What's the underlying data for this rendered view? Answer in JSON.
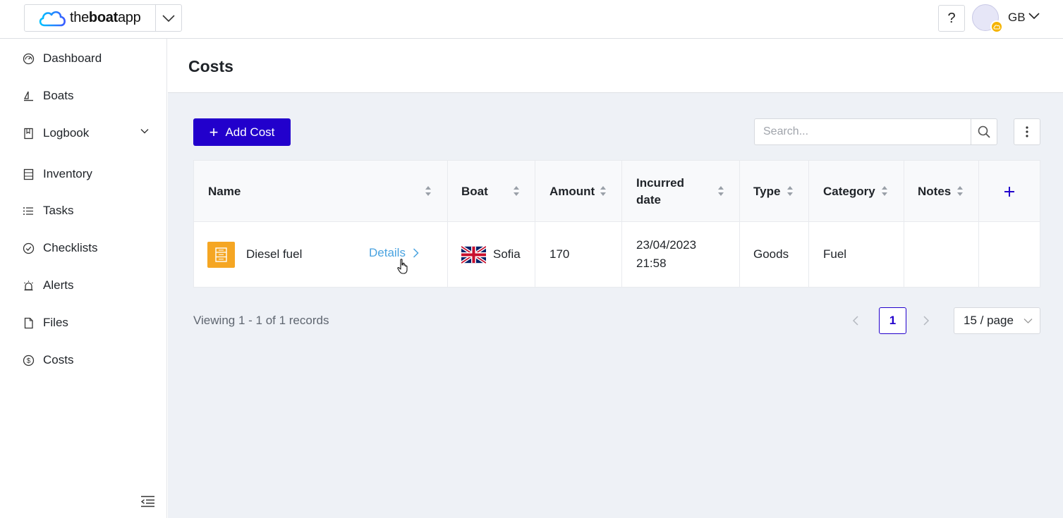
{
  "brand": {
    "name_prefix": "the",
    "name_bold": "boat",
    "name_suffix": "app"
  },
  "topbar": {
    "help_label": "?",
    "user_initials": "GB"
  },
  "sidebar": {
    "items": [
      {
        "label": "Dashboard",
        "icon": "dashboard-icon"
      },
      {
        "label": "Boats",
        "icon": "sailboat-icon"
      },
      {
        "label": "Logbook",
        "icon": "book-icon"
      },
      {
        "label": "Inventory",
        "icon": "inventory-icon"
      },
      {
        "label": "Tasks",
        "icon": "list-icon"
      },
      {
        "label": "Checklists",
        "icon": "check-circle-icon"
      },
      {
        "label": "Alerts",
        "icon": "alarm-icon"
      },
      {
        "label": "Files",
        "icon": "file-icon"
      },
      {
        "label": "Costs",
        "icon": "dollar-circle-icon"
      }
    ]
  },
  "page": {
    "title": "Costs"
  },
  "toolbar": {
    "add_label": "Add Cost",
    "search_placeholder": "Search..."
  },
  "table": {
    "columns": {
      "name": "Name",
      "boat": "Boat",
      "amount": "Amount",
      "incurred_line1": "Incurred",
      "incurred_line2": "date",
      "type": "Type",
      "category": "Category",
      "notes": "Notes"
    },
    "rows": [
      {
        "name": "Diesel fuel",
        "details_label": "Details",
        "boat": "Sofia",
        "boat_flag": "uk-flag-icon",
        "amount": "170",
        "date": "23/04/2023",
        "time": "21:58",
        "type": "Goods",
        "category": "Fuel",
        "notes": ""
      }
    ]
  },
  "footer": {
    "viewing": "Viewing 1 - 1 of 1 records",
    "current_page": "1",
    "page_size": "15 / page"
  },
  "colors": {
    "primary": "#2200cc",
    "link": "#4aa3e0",
    "cost_icon": "#f5a623",
    "main_bg": "#eef1f6"
  }
}
